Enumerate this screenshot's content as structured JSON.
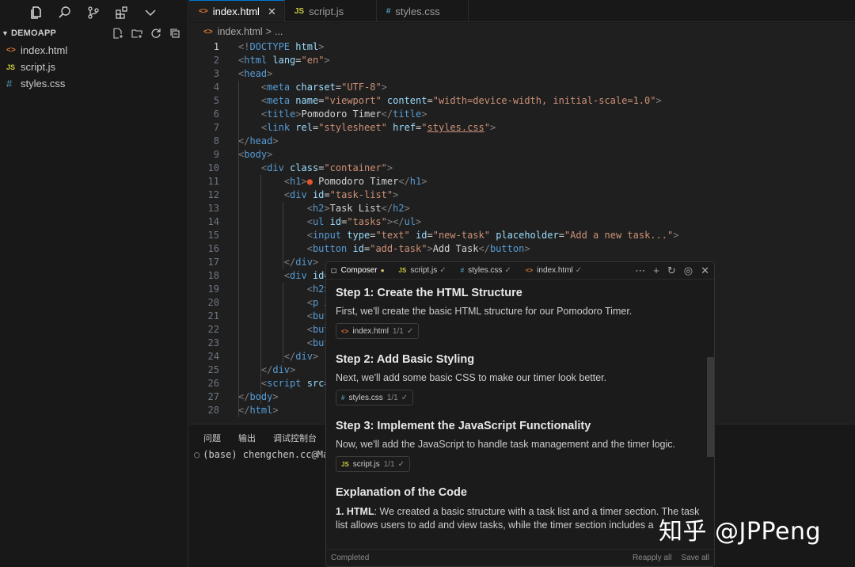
{
  "sidebar": {
    "icons": [
      "files-icon",
      "search-icon",
      "source-control-icon",
      "extensions-icon",
      "chevron-down-icon"
    ],
    "explorer_title": "DEMOAPP",
    "files": [
      {
        "name": "index.html",
        "type": "html",
        "icon": "<>"
      },
      {
        "name": "script.js",
        "type": "js",
        "icon": "JS"
      },
      {
        "name": "styles.css",
        "type": "css",
        "icon": "#"
      }
    ]
  },
  "tabs": [
    {
      "label": "index.html",
      "icon": "<>",
      "active": true
    },
    {
      "label": "script.js",
      "icon": "JS",
      "active": false
    },
    {
      "label": "styles.css",
      "icon": "#",
      "active": false
    }
  ],
  "breadcrumb": {
    "file": "index.html",
    "sep": ">",
    "rest": "..."
  },
  "editor": {
    "line_numbers": [
      "1",
      "2",
      "3",
      "4",
      "5",
      "6",
      "7",
      "8",
      "9",
      "10",
      "11",
      "12",
      "13",
      "14",
      "15",
      "16",
      "17",
      "18",
      "19",
      "20",
      "21",
      "22",
      "23",
      "24",
      "25",
      "26",
      "27",
      "28"
    ]
  },
  "panel": {
    "tabs": [
      "问题",
      "输出",
      "调试控制台"
    ],
    "terminal_line": "(base) chengchen.cc@Mac"
  },
  "composer": {
    "tabs": [
      {
        "label": "Composer",
        "icon": "▢"
      },
      {
        "label": "script.js",
        "icon": "JS"
      },
      {
        "label": "styles.css",
        "icon": "#"
      },
      {
        "label": "index.html",
        "icon": "<>"
      }
    ],
    "steps": [
      {
        "title": "Step 1: Create the HTML Structure",
        "desc": "First, we'll create the basic HTML structure for our Pomodoro Timer.",
        "chip": "index.html",
        "chip_icon": "<>",
        "count": "1/1"
      },
      {
        "title": "Step 2: Add Basic Styling",
        "desc": "Next, we'll add some basic CSS to make our timer look better.",
        "chip": "styles.css",
        "chip_icon": "#",
        "count": "1/1"
      },
      {
        "title": "Step 3: Implement the JavaScript Functionality",
        "desc": "Now, we'll add the JavaScript to handle task management and the timer logic.",
        "chip": "script.js",
        "chip_icon": "JS",
        "count": "1/1"
      }
    ],
    "explanation_title": "Explanation of the Code",
    "explanation_label": "1. HTML",
    "explanation_text": ": We created a basic structure with a task list and a timer section. The task list allows users to add and view tasks, while the timer section includes a",
    "footer_status": "Completed",
    "reapply_all": "Reapply all",
    "save_all": "Save all"
  },
  "watermark": "知乎 @JPPeng",
  "colors": {
    "accent": "#0078d4",
    "html_icon": "#e37933",
    "js_icon": "#cbcb41",
    "css_icon": "#519aba"
  }
}
